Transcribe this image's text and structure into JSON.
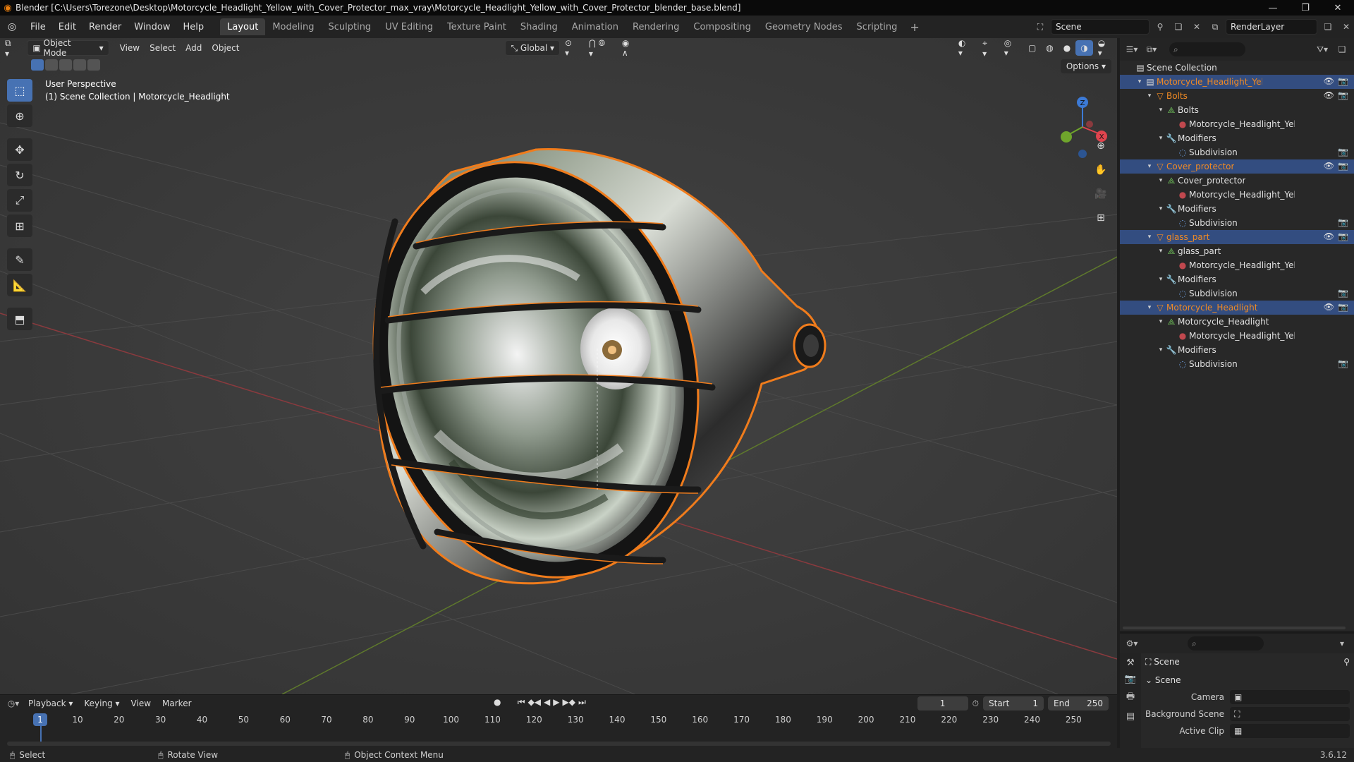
{
  "titlebar": {
    "title": "Blender [C:\\Users\\Torezone\\Desktop\\Motorcycle_Headlight_Yellow_with_Cover_Protector_max_vray\\Motorcycle_Headlight_Yellow_with_Cover_Protector_blender_base.blend]",
    "minimize": "—",
    "maximize": "❐",
    "close": "✕"
  },
  "menubar": {
    "menus": [
      "File",
      "Edit",
      "Render",
      "Window",
      "Help"
    ],
    "tabs": [
      "Layout",
      "Modeling",
      "Sculpting",
      "UV Editing",
      "Texture Paint",
      "Shading",
      "Animation",
      "Rendering",
      "Compositing",
      "Geometry Nodes",
      "Scripting"
    ],
    "active_tab": "Layout",
    "scene": "Scene",
    "view_layer": "RenderLayer"
  },
  "viewport": {
    "mode": "Object Mode",
    "menus": [
      "View",
      "Select",
      "Add",
      "Object"
    ],
    "orientation": "Global",
    "options": "Options",
    "info_line1": "User Perspective",
    "info_line2": "(1) Scene Collection | Motorcycle_Headlight",
    "gizmo_axes": [
      "Z",
      "X"
    ],
    "colors": {
      "x_axis": "#e0444e",
      "y_axis": "#6fa52c",
      "z_axis": "#3c7ad6",
      "selection": "#f07c1c"
    }
  },
  "outliner": {
    "rows": [
      {
        "label": "Scene Collection",
        "icon": "collection-icon",
        "style": "normal",
        "eye": "",
        "cam": ""
      },
      {
        "label": "Motorcycle_Headlight_Yellow_with_Cov",
        "icon": "collection-icon",
        "style": "orange",
        "eye": "👁",
        "cam": "📷"
      },
      {
        "label": "Bolts",
        "icon": "mesh-object-icon",
        "style": "orange",
        "eye": "👁",
        "cam": "📷"
      },
      {
        "label": "Bolts",
        "icon": "mesh-data-icon",
        "style": "normal",
        "eye": "",
        "cam": ""
      },
      {
        "label": "Motorcycle_Headlight_Yellc",
        "icon": "material-icon",
        "style": "normal",
        "eye": "",
        "cam": ""
      },
      {
        "label": "Modifiers",
        "icon": "wrench-icon",
        "style": "normal",
        "eye": "",
        "cam": ""
      },
      {
        "label": "Subdivision",
        "icon": "subdivision-icon",
        "style": "normal",
        "eye": "",
        "cam": "📷"
      },
      {
        "label": "Cover_protector",
        "icon": "mesh-object-icon",
        "style": "orange",
        "eye": "👁",
        "cam": "📷"
      },
      {
        "label": "Cover_protector",
        "icon": "mesh-data-icon",
        "style": "normal",
        "eye": "",
        "cam": ""
      },
      {
        "label": "Motorcycle_Headlight_Yellc",
        "icon": "material-icon",
        "style": "normal",
        "eye": "",
        "cam": ""
      },
      {
        "label": "Modifiers",
        "icon": "wrench-icon",
        "style": "normal",
        "eye": "",
        "cam": ""
      },
      {
        "label": "Subdivision",
        "icon": "subdivision-icon",
        "style": "normal",
        "eye": "",
        "cam": "📷"
      },
      {
        "label": "glass_part",
        "icon": "mesh-object-icon",
        "style": "orange",
        "eye": "👁",
        "cam": "📷"
      },
      {
        "label": "glass_part",
        "icon": "mesh-data-icon",
        "style": "normal",
        "eye": "",
        "cam": ""
      },
      {
        "label": "Motorcycle_Headlight_Yellc",
        "icon": "material-icon",
        "style": "normal",
        "eye": "",
        "cam": ""
      },
      {
        "label": "Modifiers",
        "icon": "wrench-icon",
        "style": "normal",
        "eye": "",
        "cam": ""
      },
      {
        "label": "Subdivision",
        "icon": "subdivision-icon",
        "style": "normal",
        "eye": "",
        "cam": "📷"
      },
      {
        "label": "Motorcycle_Headlight",
        "icon": "mesh-object-icon",
        "style": "orange",
        "eye": "👁",
        "cam": "📷"
      },
      {
        "label": "Motorcycle_Headlight",
        "icon": "mesh-data-icon",
        "style": "normal",
        "eye": "",
        "cam": ""
      },
      {
        "label": "Motorcycle_Headlight_Yellc",
        "icon": "material-icon",
        "style": "normal",
        "eye": "",
        "cam": ""
      },
      {
        "label": "Modifiers",
        "icon": "wrench-icon",
        "style": "normal",
        "eye": "",
        "cam": ""
      },
      {
        "label": "Subdivision",
        "icon": "subdivision-icon",
        "style": "normal",
        "eye": "",
        "cam": "📷"
      }
    ]
  },
  "properties": {
    "context": "Scene",
    "panel": "Scene",
    "camera_label": "Camera",
    "background_label": "Background Scene",
    "active_clip_label": "Active Clip"
  },
  "timeline": {
    "menus": [
      "Playback",
      "Keying",
      "View",
      "Marker"
    ],
    "current_frame": "1",
    "start_label": "Start",
    "start": "1",
    "end_label": "End",
    "end": "250",
    "ticks": [
      "1",
      "10",
      "20",
      "30",
      "40",
      "50",
      "60",
      "70",
      "80",
      "90",
      "100",
      "110",
      "120",
      "130",
      "140",
      "150",
      "160",
      "170",
      "180",
      "190",
      "200",
      "210",
      "220",
      "230",
      "240",
      "250"
    ]
  },
  "statusbar": {
    "select": "Select",
    "rotate": "Rotate View",
    "context_menu": "Object Context Menu",
    "version": "3.6.12"
  }
}
